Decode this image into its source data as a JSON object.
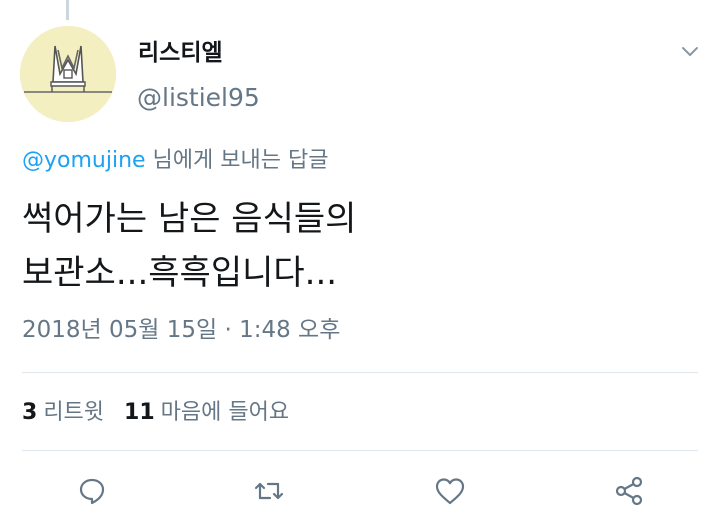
{
  "user": {
    "display_name": "리스티엘",
    "handle": "@listiel95"
  },
  "reply_to": {
    "mention": "@yomujine",
    "suffix": " 님에게 보내는 답글"
  },
  "tweet": {
    "lines": [
      "썩어가는 남은 음식들의",
      "보관소...흑흑입니다..."
    ]
  },
  "timestamp": "2018년 05월 15일 · 1:48 오후",
  "stats": {
    "retweets_count": "3",
    "retweets_label": "리트윗",
    "likes_count": "11",
    "likes_label": "마음에 들어요"
  },
  "icons": {
    "reply": "reply-icon",
    "retweet": "retweet-icon",
    "like": "heart-icon",
    "share": "share-icon",
    "menu": "chevron-down-icon"
  },
  "colors": {
    "text": "#14171a",
    "secondary": "#657786",
    "link": "#1da1f2",
    "divider": "#e1e8ed",
    "avatar_bg": "#f3efc0"
  }
}
